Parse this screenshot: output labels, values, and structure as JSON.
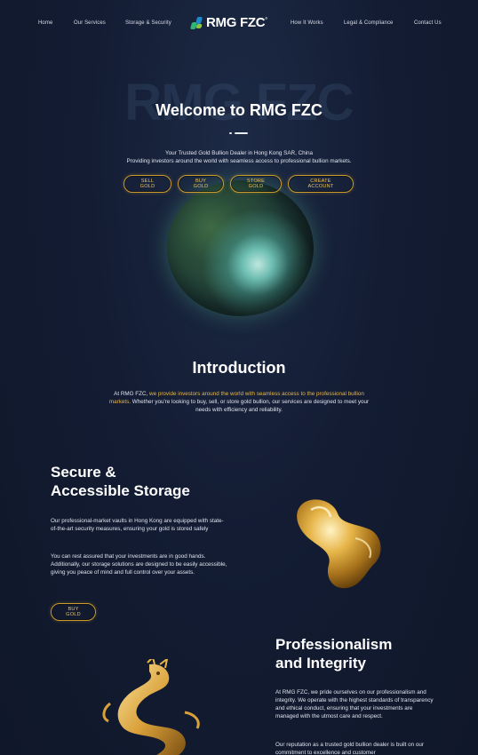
{
  "nav": {
    "left": [
      "Home",
      "Our Services",
      "Storage & Security"
    ],
    "right": [
      "How It Works",
      "Legal & Compliance",
      "Contact Us"
    ],
    "logo_text": "RMG FZC",
    "logo_mark": "reg"
  },
  "hero": {
    "bg_text": "RMG FZC",
    "title": "Welcome to RMG FZC",
    "sub_line1": "Your Trusted Gold Bullion Dealer in Hong Kong SAR, China",
    "sub_line2": "Providing investors around the world with seamless access to professional bullion markets.",
    "buttons": [
      "SELL GOLD",
      "BUY GOLD",
      "STORE GOLD",
      "CREATE ACCOUNT"
    ]
  },
  "intro": {
    "title": "Introduction",
    "text_prefix": "At RMG FZC, ",
    "text_highlight": "we provide investors around the world with seamless access to the professional bullion markets",
    "text_suffix": ". Whether you're looking to buy, sell, or store gold bullion, our services are designed to meet your needs with efficiency and reliability."
  },
  "storage": {
    "title_line1": "Secure &",
    "title_line2": "Accessible Storage",
    "p1": "Our professional-market vaults in Hong Kong are equipped with state-of-the-art security measures, ensuring your gold is stored safely",
    "p2": "You can rest assured that your investments are in good hands. Additionally, our storage solutions are designed to be easily accessible, giving you peace of mind and full control over your assets.",
    "button": "BUY GOLD"
  },
  "integrity": {
    "title_line1": "Professionalism",
    "title_line2": "and Integrity",
    "p1": "At RMG FZC, we pride ourselves on our professionalism and integrity. We operate with the highest standards of transparency and ethical conduct, ensuring that your investments are managed with the utmost care and respect.",
    "p2": "Our reputation as a trusted gold bullion dealer is built on our commitment to excellence and customer"
  },
  "colors": {
    "gold": "#c99a2e",
    "gold_text": "#f0c45a",
    "highlight": "#e7b64a",
    "bg": "#131c33"
  },
  "icons": {
    "logo": "rmg-logo-mark-icon",
    "planet": "planet-globe-image",
    "blob": "liquid-gold-sculpture-image",
    "dragon": "gold-dragon-image"
  }
}
